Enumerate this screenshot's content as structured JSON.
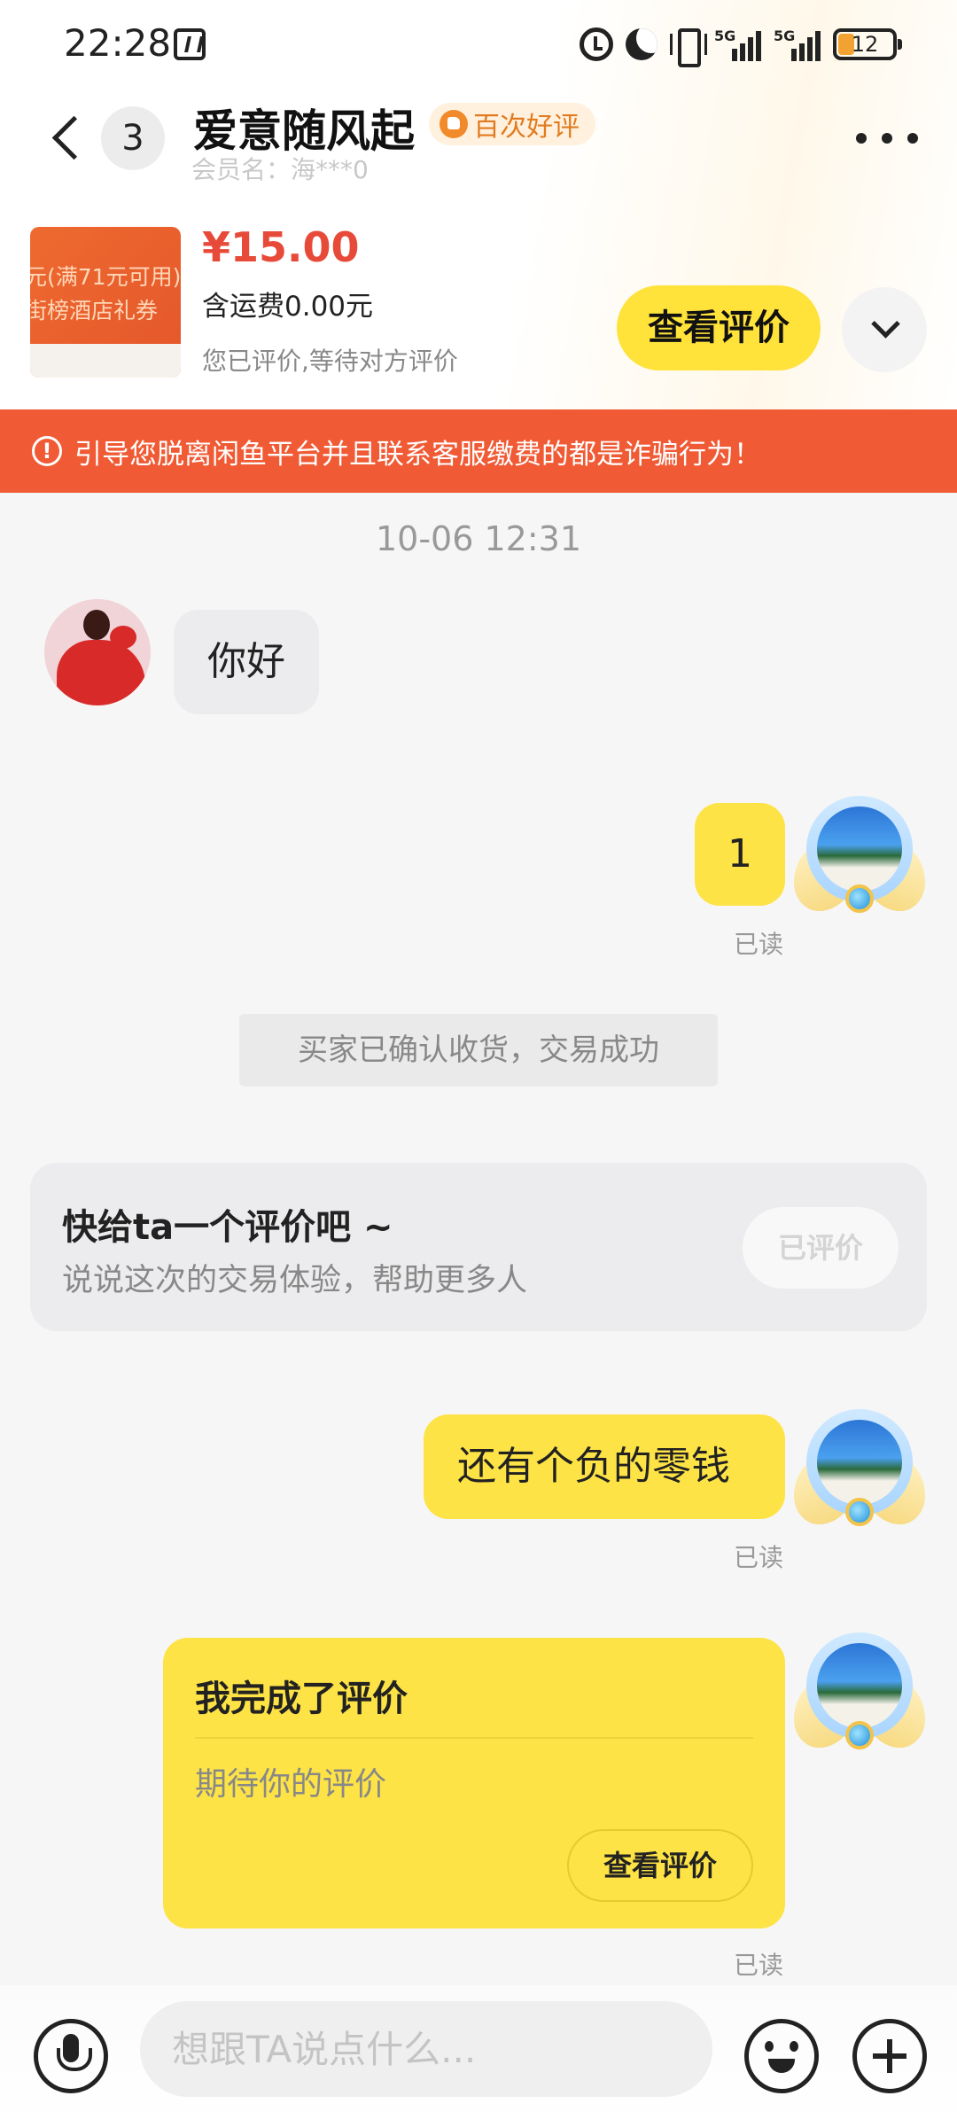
{
  "status_bar": {
    "time": "22:28",
    "network_label": "5G",
    "battery": "12"
  },
  "header": {
    "unread_count": "3",
    "contact_name": "爱意随风起",
    "rating_badge": "百次好评",
    "member_name": "会员名：海***0"
  },
  "product": {
    "thumbnail_text_line1": "元(满71元可用)",
    "thumbnail_text_line2": "街榜酒店礼券",
    "price": "¥15.00",
    "shipping": "含运费0.00元",
    "review_status": "您已评价,等待对方评价",
    "view_review_label": "查看评价"
  },
  "warning": {
    "text": "引导您脱离闲鱼平台并且联系客服缴费的都是诈骗行为！"
  },
  "chat": {
    "timestamp": "10-06 12:31",
    "msg_hello": "你好",
    "msg_1": "1",
    "read_label_1": "已读",
    "system_notice": "买家已确认收货，交易成功",
    "review_prompt": {
      "title": "快给ta一个评价吧 ~",
      "subtitle": "说说这次的交易体验，帮助更多人",
      "button": "已评价"
    },
    "msg_change": "还有个负的零钱",
    "read_label_2": "已读",
    "review_done": {
      "title": "我完成了评价",
      "subtitle": "期待你的评价",
      "button": "查看评价"
    },
    "read_label_3": "已读"
  },
  "input_bar": {
    "placeholder": "想跟TA说点什么..."
  }
}
